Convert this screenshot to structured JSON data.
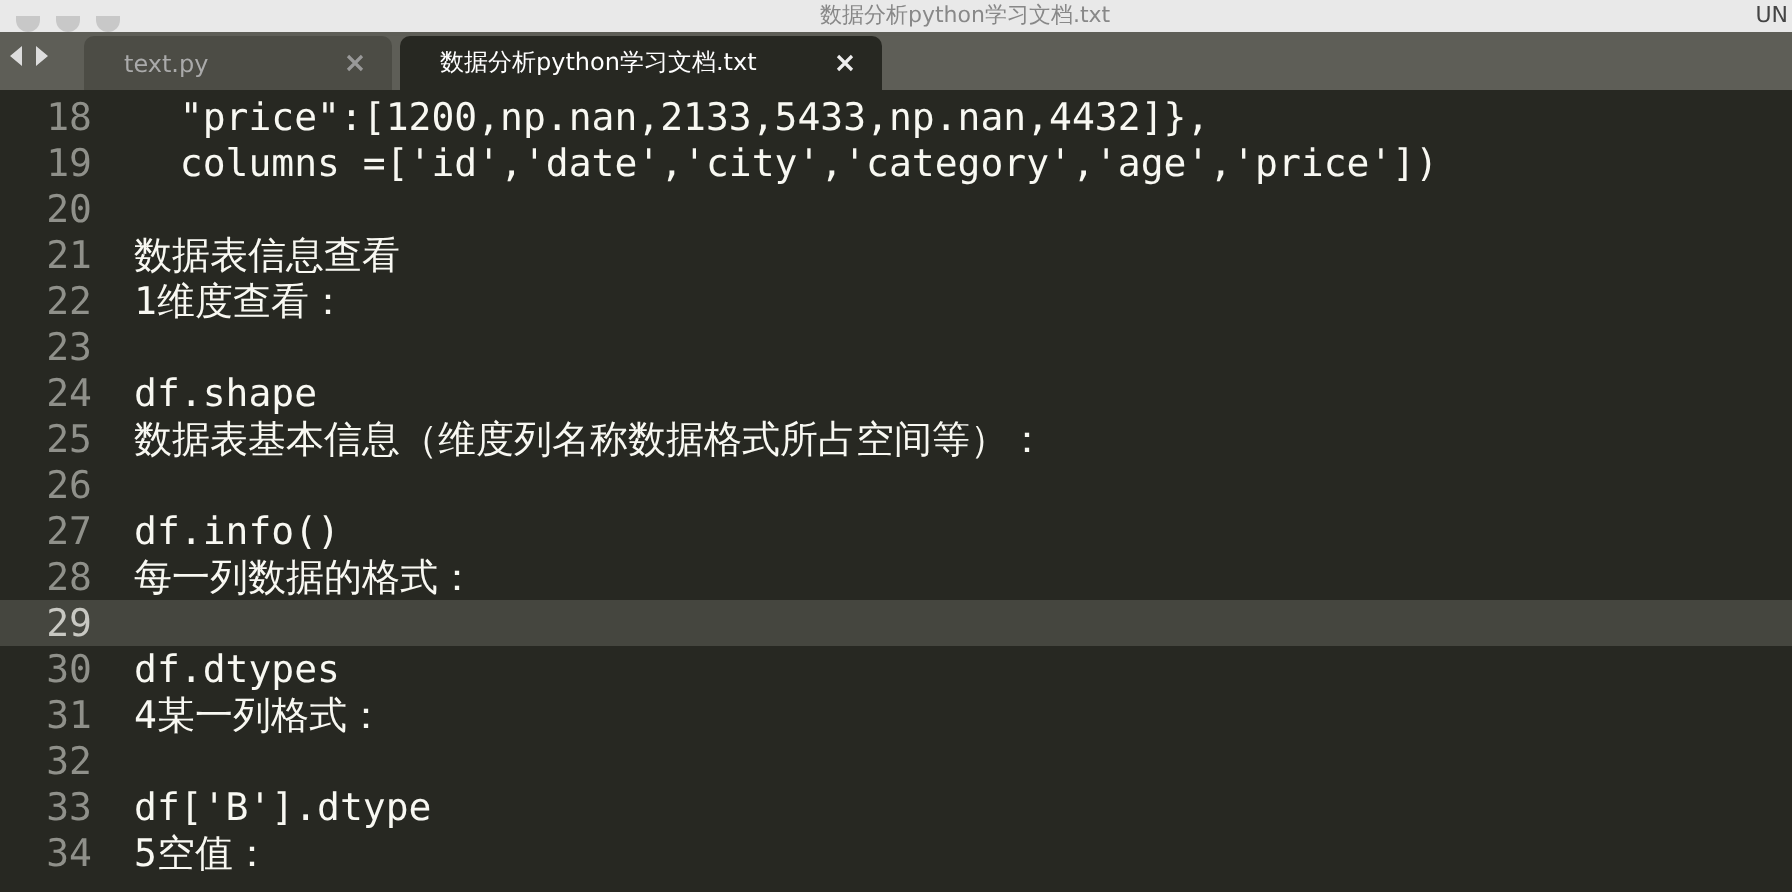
{
  "window": {
    "title": "数据分析python学习文档.txt",
    "badge": "UN"
  },
  "tabs": [
    {
      "label": "text.py",
      "selected": false
    },
    {
      "label": "数据分析python学习文档.txt",
      "selected": true
    }
  ],
  "editor": {
    "lines": [
      {
        "number": "18",
        "text": "  \"price\":[1200,np.nan,2133,5433,np.nan,4432]},",
        "current": false
      },
      {
        "number": "19",
        "text": "  columns =['id','date','city','category','age','price'])",
        "current": false
      },
      {
        "number": "20",
        "current": false
      },
      {
        "number": "21",
        "text": "数据表信息查看",
        "current": false
      },
      {
        "number": "22",
        "text": "1维度查看：",
        "current": false
      },
      {
        "number": "23",
        "current": false
      },
      {
        "number": "24",
        "text": "df.shape",
        "current": false
      },
      {
        "number": "25",
        "text": "数据表基本信息（维度列名称数据格式所占空间等）：",
        "current": false
      },
      {
        "number": "26",
        "current": false
      },
      {
        "number": "27",
        "text": "df.info()",
        "current": false
      },
      {
        "number": "28",
        "text": "每一列数据的格式：",
        "current": false
      },
      {
        "number": "29",
        "current": true
      },
      {
        "number": "30",
        "text": "df.dtypes",
        "current": false
      },
      {
        "number": "31",
        "text": "4某一列格式：",
        "current": false
      },
      {
        "number": "32",
        "current": false
      },
      {
        "number": "33",
        "text": "df['B'].dtype",
        "current": false
      },
      {
        "number": "34",
        "text": "5空值：",
        "current": false
      }
    ]
  }
}
